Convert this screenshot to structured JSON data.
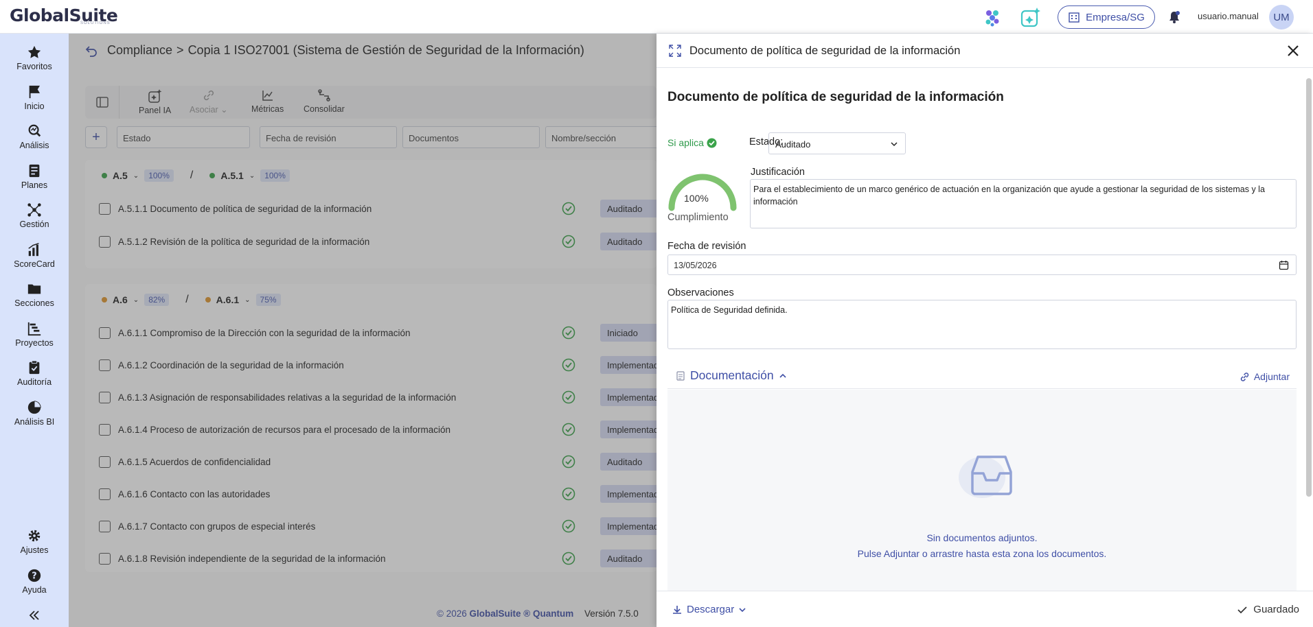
{
  "topbar": {
    "logo": "GlobalSuite",
    "logo_sub": "SOLUTIONS",
    "company": "Empresa/SG",
    "username": "usuario.manual",
    "avatar": "UM"
  },
  "sidebar": {
    "items": [
      {
        "label": "Favoritos",
        "icon": "star-icon"
      },
      {
        "label": "Inicio",
        "icon": "flag-icon"
      },
      {
        "label": "Análisis",
        "icon": "analysis-icon"
      },
      {
        "label": "Planes",
        "icon": "plans-icon"
      },
      {
        "label": "Gestión",
        "icon": "network-icon"
      },
      {
        "label": "ScoreCard",
        "icon": "bar-chart-icon"
      },
      {
        "label": "Secciones",
        "icon": "folder-icon"
      },
      {
        "label": "Proyectos",
        "icon": "gantt-icon"
      },
      {
        "label": "Auditoría",
        "icon": "clipboard-icon"
      },
      {
        "label": "Análisis BI",
        "icon": "pie-icon"
      }
    ],
    "bottom": [
      {
        "label": "Ajustes",
        "icon": "gear-icon"
      },
      {
        "label": "Ayuda",
        "icon": "help-icon"
      }
    ]
  },
  "main": {
    "breadcrumb_root": "Compliance",
    "breadcrumb_sep": ">",
    "breadcrumb_current": "Copia 1 ISO27001 (Sistema de Gestión de Seguridad de la Información)",
    "toolbar": {
      "panel_ia": "Panel IA",
      "asociar": "Asociar",
      "metricas": "Métricas",
      "consolidar": "Consolidar"
    },
    "filters": {
      "add": "+",
      "estado": "Estado",
      "fecha": "Fecha de revisión",
      "documentos": "Documentos",
      "nombre": "Nombre/sección"
    },
    "groups": [
      {
        "code": "A.5",
        "pct": "100%",
        "sub_code": "A.5.1",
        "sub_pct": "100%",
        "color": "#3aa34a",
        "rows": [
          {
            "label": "A.5.1.1 Documento de política de seguridad de la información",
            "status": "Auditado"
          },
          {
            "label": "A.5.1.2 Revisión de la política de seguridad de la información",
            "status": "Auditado"
          }
        ]
      },
      {
        "code": "A.6",
        "pct": "82%",
        "sub_code": "A.6.1",
        "sub_pct": "75%",
        "color": "#e0962e",
        "rows": [
          {
            "label": "A.6.1.1 Compromiso de la Dirección con la seguridad de la información",
            "status": "Iniciado"
          },
          {
            "label": "A.6.1.2 Coordinación de la seguridad de la información",
            "status": "Implementado"
          },
          {
            "label": "A.6.1.3 Asignación de responsabilidades relativas a la seguridad de la información",
            "status": "Implementado"
          },
          {
            "label": "A.6.1.4 Proceso de autorización de recursos para el procesado de la información",
            "status": "Implementado"
          },
          {
            "label": "A.6.1.5 Acuerdos de confidencialidad",
            "status": "Auditado"
          },
          {
            "label": "A.6.1.6 Contacto con las autoridades",
            "status": "Implementado"
          },
          {
            "label": "A.6.1.7 Contacto con grupos de especial interés",
            "status": "Implementado"
          },
          {
            "label": "A.6.1.8 Revisión independiente de la seguridad de la información",
            "status": "Auditado"
          }
        ]
      }
    ],
    "footer_copy": "© 2026",
    "footer_brand": "GlobalSuite ® Quantum",
    "footer_version": "Versión 7.5.0"
  },
  "panel": {
    "header_title": "Documento de política de seguridad de la información",
    "doc_title": "Documento de política de seguridad de la información",
    "si_aplica": "Si aplica",
    "estado_label": "Estado:",
    "estado_value": "Auditado",
    "cumplimiento_value": "100%",
    "cumplimiento_fraction": 1.0,
    "cumplimiento_label": "Cumplimiento",
    "justificacion_label": "Justificación",
    "justificacion_value": "Para el establecimiento de un marco genérico de actuación en la organización que ayude a gestionar la seguridad de los sistemas y la información",
    "fecha_label": "Fecha de revisión",
    "fecha_value": "13/05/2026",
    "observaciones_label": "Observaciones",
    "observaciones_value": "Política de Seguridad definida.",
    "documentacion_label": "Documentación",
    "adjuntar_label": "Adjuntar",
    "empty_line1": "Sin documentos adjuntos.",
    "empty_line2": "Pulse Adjuntar o arrastre hasta esta zona los documentos.",
    "descargar_label": "Descargar",
    "guardado_label": "Guardado"
  },
  "colors": {
    "accent": "#3f4fa6",
    "sidebar_bg": "#d9e3fb",
    "success": "#3aa34a"
  }
}
